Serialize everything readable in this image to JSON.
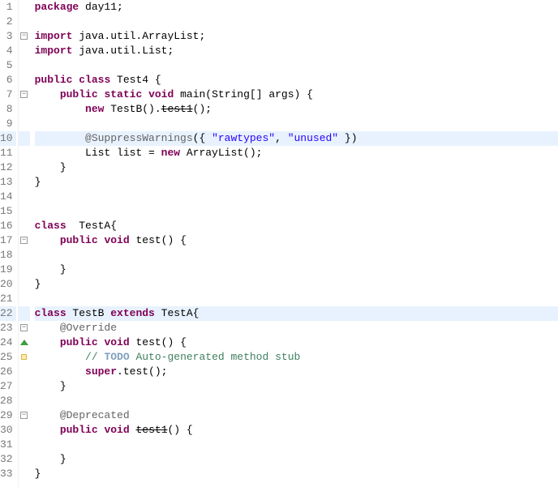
{
  "lines": [
    {
      "num": "1",
      "fold": "",
      "mark": "",
      "tokens": [
        {
          "t": "package",
          "c": "kw"
        },
        {
          "t": " day11;",
          "c": "plain"
        }
      ]
    },
    {
      "num": "2",
      "fold": "",
      "mark": "",
      "tokens": []
    },
    {
      "num": "3",
      "fold": "minus",
      "mark": "",
      "tokens": [
        {
          "t": "import",
          "c": "kw"
        },
        {
          "t": " java.util.ArrayList;",
          "c": "plain"
        }
      ]
    },
    {
      "num": "4",
      "fold": "",
      "mark": "",
      "tokens": [
        {
          "t": "import",
          "c": "kw"
        },
        {
          "t": " java.util.List;",
          "c": "plain"
        }
      ]
    },
    {
      "num": "5",
      "fold": "",
      "mark": "",
      "tokens": []
    },
    {
      "num": "6",
      "fold": "",
      "mark": "",
      "tokens": [
        {
          "t": "public",
          "c": "kw"
        },
        {
          "t": " ",
          "c": "plain"
        },
        {
          "t": "class",
          "c": "kw"
        },
        {
          "t": " Test4 {",
          "c": "plain"
        }
      ]
    },
    {
      "num": "7",
      "fold": "minus",
      "mark": "",
      "tokens": [
        {
          "t": "    ",
          "c": "plain"
        },
        {
          "t": "public",
          "c": "kw"
        },
        {
          "t": " ",
          "c": "plain"
        },
        {
          "t": "static",
          "c": "kw"
        },
        {
          "t": " ",
          "c": "plain"
        },
        {
          "t": "void",
          "c": "kw"
        },
        {
          "t": " main(String[] args) {",
          "c": "plain"
        }
      ]
    },
    {
      "num": "8",
      "fold": "",
      "mark": "",
      "tokens": [
        {
          "t": "        ",
          "c": "plain"
        },
        {
          "t": "new",
          "c": "kw"
        },
        {
          "t": " TestB().",
          "c": "plain"
        },
        {
          "t": "test1",
          "c": "dep"
        },
        {
          "t": "();",
          "c": "plain"
        }
      ]
    },
    {
      "num": "9",
      "fold": "",
      "mark": "",
      "tokens": []
    },
    {
      "num": "10",
      "fold": "",
      "mark": "",
      "hl": true,
      "tokens": [
        {
          "t": "        ",
          "c": "plain"
        },
        {
          "t": "@SuppressWarnings",
          "c": "ann"
        },
        {
          "t": "({ ",
          "c": "plain"
        },
        {
          "t": "\"rawtypes\"",
          "c": "str"
        },
        {
          "t": ", ",
          "c": "plain"
        },
        {
          "t": "\"unused\"",
          "c": "str"
        },
        {
          "t": " })",
          "c": "plain"
        }
      ]
    },
    {
      "num": "11",
      "fold": "",
      "mark": "",
      "tokens": [
        {
          "t": "        List list = ",
          "c": "plain"
        },
        {
          "t": "new",
          "c": "kw"
        },
        {
          "t": " ArrayList();",
          "c": "plain"
        }
      ]
    },
    {
      "num": "12",
      "fold": "",
      "mark": "",
      "tokens": [
        {
          "t": "    }",
          "c": "plain"
        }
      ]
    },
    {
      "num": "13",
      "fold": "",
      "mark": "",
      "tokens": [
        {
          "t": "}",
          "c": "plain"
        }
      ]
    },
    {
      "num": "14",
      "fold": "",
      "mark": "",
      "tokens": []
    },
    {
      "num": "15",
      "fold": "",
      "mark": "",
      "tokens": []
    },
    {
      "num": "16",
      "fold": "",
      "mark": "",
      "tokens": [
        {
          "t": "class",
          "c": "kw"
        },
        {
          "t": "  TestA{",
          "c": "plain"
        }
      ]
    },
    {
      "num": "17",
      "fold": "minus",
      "mark": "",
      "tokens": [
        {
          "t": "    ",
          "c": "plain"
        },
        {
          "t": "public",
          "c": "kw"
        },
        {
          "t": " ",
          "c": "plain"
        },
        {
          "t": "void",
          "c": "kw"
        },
        {
          "t": " test() {",
          "c": "plain"
        }
      ]
    },
    {
      "num": "18",
      "fold": "",
      "mark": "",
      "tokens": []
    },
    {
      "num": "19",
      "fold": "",
      "mark": "",
      "tokens": [
        {
          "t": "    }",
          "c": "plain"
        }
      ]
    },
    {
      "num": "20",
      "fold": "",
      "mark": "",
      "tokens": [
        {
          "t": "}",
          "c": "plain"
        }
      ]
    },
    {
      "num": "21",
      "fold": "",
      "mark": "",
      "tokens": []
    },
    {
      "num": "22",
      "fold": "",
      "mark": "",
      "hl": true,
      "tokens": [
        {
          "t": "class",
          "c": "kw"
        },
        {
          "t": " TestB ",
          "c": "plain"
        },
        {
          "t": "extends",
          "c": "kw"
        },
        {
          "t": " TestA{",
          "c": "plain"
        }
      ]
    },
    {
      "num": "23",
      "fold": "minus",
      "mark": "",
      "tokens": [
        {
          "t": "    ",
          "c": "plain"
        },
        {
          "t": "@Override",
          "c": "ann"
        }
      ]
    },
    {
      "num": "24",
      "fold": "",
      "mark": "override",
      "tokens": [
        {
          "t": "    ",
          "c": "plain"
        },
        {
          "t": "public",
          "c": "kw"
        },
        {
          "t": " ",
          "c": "plain"
        },
        {
          "t": "void",
          "c": "kw"
        },
        {
          "t": " test() {",
          "c": "plain"
        }
      ]
    },
    {
      "num": "25",
      "fold": "",
      "mark": "hint",
      "tokens": [
        {
          "t": "        ",
          "c": "plain"
        },
        {
          "t": "// ",
          "c": "cmt"
        },
        {
          "t": "TODO",
          "c": "todo"
        },
        {
          "t": " Auto-generated method stub",
          "c": "cmt"
        }
      ]
    },
    {
      "num": "26",
      "fold": "",
      "mark": "",
      "tokens": [
        {
          "t": "        ",
          "c": "plain"
        },
        {
          "t": "super",
          "c": "kw"
        },
        {
          "t": ".test();",
          "c": "plain"
        }
      ]
    },
    {
      "num": "27",
      "fold": "",
      "mark": "",
      "tokens": [
        {
          "t": "    }",
          "c": "plain"
        }
      ]
    },
    {
      "num": "28",
      "fold": "",
      "mark": "",
      "tokens": []
    },
    {
      "num": "29",
      "fold": "minus",
      "mark": "",
      "tokens": [
        {
          "t": "    ",
          "c": "plain"
        },
        {
          "t": "@Deprecated",
          "c": "ann"
        }
      ]
    },
    {
      "num": "30",
      "fold": "",
      "mark": "",
      "tokens": [
        {
          "t": "    ",
          "c": "plain"
        },
        {
          "t": "public",
          "c": "kw"
        },
        {
          "t": " ",
          "c": "plain"
        },
        {
          "t": "void",
          "c": "kw"
        },
        {
          "t": " ",
          "c": "plain"
        },
        {
          "t": "test1",
          "c": "dep"
        },
        {
          "t": "() {",
          "c": "plain"
        }
      ]
    },
    {
      "num": "31",
      "fold": "",
      "mark": "",
      "tokens": []
    },
    {
      "num": "32",
      "fold": "",
      "mark": "",
      "tokens": [
        {
          "t": "    }",
          "c": "plain"
        }
      ]
    },
    {
      "num": "33",
      "fold": "",
      "mark": "",
      "tokens": [
        {
          "t": "}",
          "c": "plain"
        }
      ]
    }
  ]
}
